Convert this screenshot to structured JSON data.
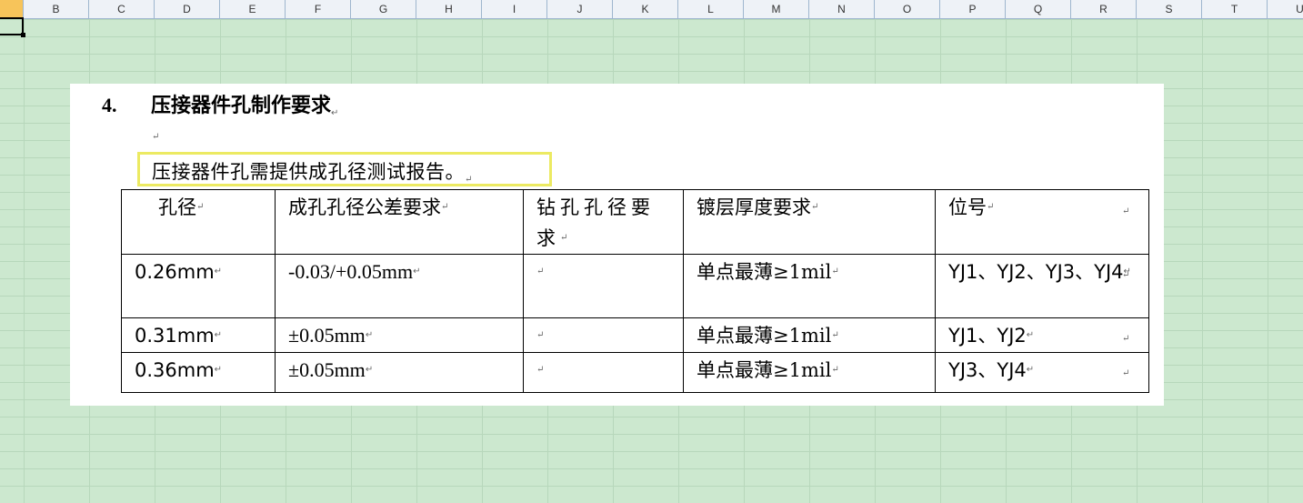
{
  "columns": [
    "B",
    "C",
    "D",
    "E",
    "F",
    "G",
    "H",
    "I",
    "J",
    "K",
    "L",
    "M",
    "N",
    "O",
    "P",
    "Q",
    "R",
    "S",
    "T",
    "U"
  ],
  "document": {
    "heading_number": "4.",
    "heading_text": "压接器件孔制作要求",
    "paragraph_mark": "↵",
    "note": "压接器件孔需提供成孔径测试报告。"
  },
  "table": {
    "headers": [
      "孔径",
      "成孔孔径公差要求",
      "钻孔孔径要求",
      "镀层厚度要求",
      "位号"
    ],
    "rows": [
      [
        "0.26mm",
        "-0.03/+0.05mm",
        "",
        "单点最薄≥1mil",
        "YJ1、YJ2、YJ3、YJ4"
      ],
      [
        "0.31mm",
        "±0.05mm",
        "",
        "单点最薄≥1mil",
        "YJ1、YJ2"
      ],
      [
        "0.36mm",
        "±0.05mm",
        "",
        "单点最薄≥1mil",
        "YJ3、YJ4"
      ]
    ]
  }
}
